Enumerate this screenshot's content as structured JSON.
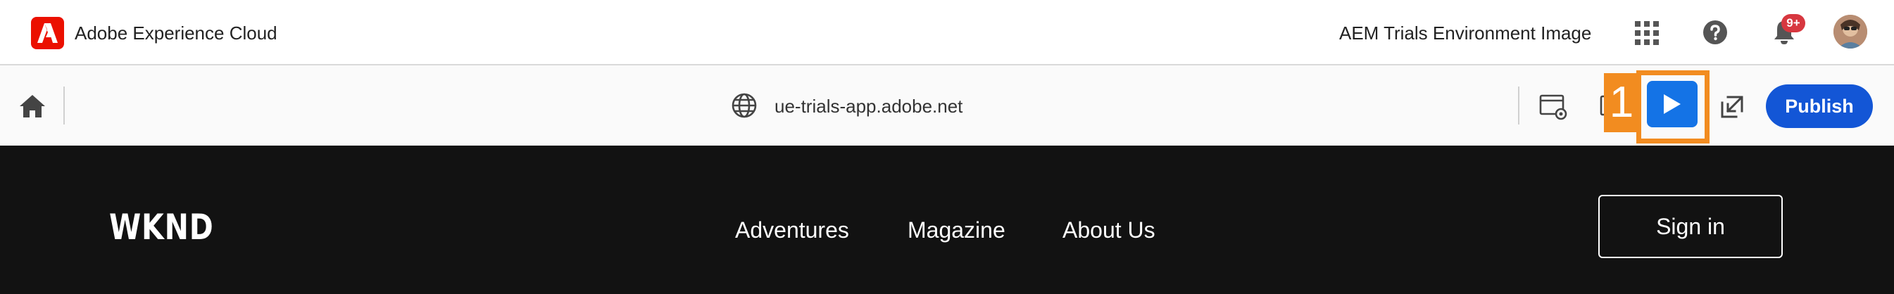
{
  "shell": {
    "title": "Adobe Experience Cloud",
    "org_name": "AEM Trials Environment Image",
    "notification_count": "9+",
    "logo_color": "#eb1000"
  },
  "toolbar": {
    "url": "ue-trials-app.adobe.net",
    "publish_label": "Publish",
    "callout_number": "1",
    "callout_color": "#f28c20",
    "accent_color": "#1473e6"
  },
  "site": {
    "logo": "WKND",
    "nav": [
      {
        "label": "Adventures"
      },
      {
        "label": "Magazine"
      },
      {
        "label": "About Us"
      }
    ],
    "sign_in_label": "Sign in"
  }
}
